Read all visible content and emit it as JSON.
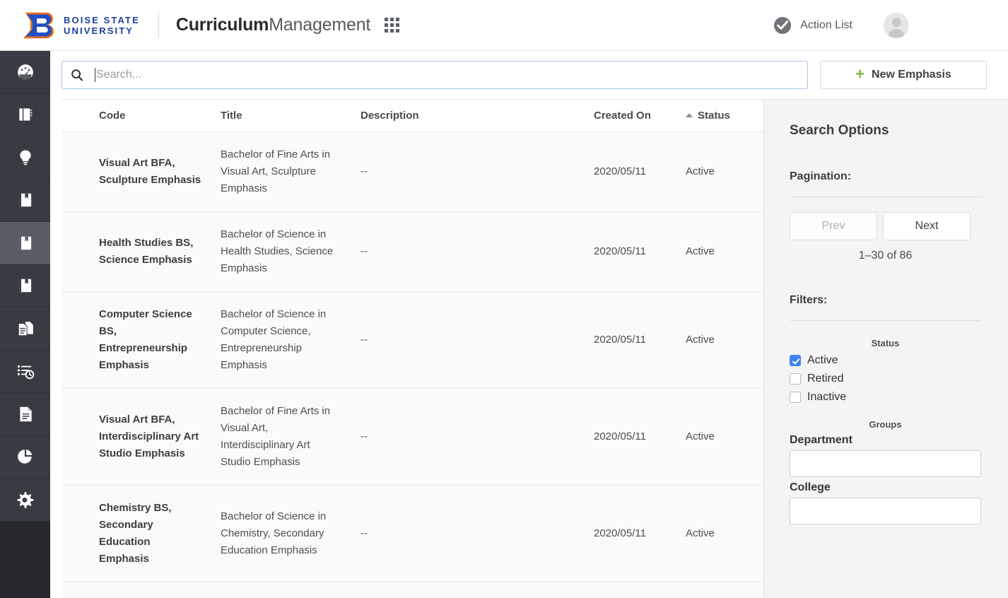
{
  "header": {
    "logo": {
      "letter": "B",
      "line1": "BOISE STATE",
      "line2": "UNIVERSITY",
      "blue": "#1f3f9e",
      "orange": "#e36c1f"
    },
    "app_title_bold": "Curriculum",
    "app_title_regular": "Management",
    "apps_grid_icon": "grid-apps-icon",
    "action_list_label": "Action List",
    "action_list_icon": "check-circle-icon",
    "avatar_icon": "user-avatar-icon"
  },
  "sidebar": {
    "items": [
      {
        "icon": "dashboard-gauge-icon",
        "active": false
      },
      {
        "icon": "book-closed-icon",
        "active": false
      },
      {
        "icon": "lightbulb-icon",
        "active": false
      },
      {
        "icon": "bookmark-book-icon",
        "active": false
      },
      {
        "icon": "bookmark-book-icon",
        "active": true
      },
      {
        "icon": "bookmark-book-icon",
        "active": false
      },
      {
        "icon": "copy-documents-icon",
        "active": false
      },
      {
        "icon": "list-clock-icon",
        "active": false
      },
      {
        "icon": "document-file-icon",
        "active": false
      },
      {
        "icon": "pie-chart-icon",
        "active": false
      },
      {
        "icon": "gear-settings-icon",
        "active": false
      }
    ]
  },
  "toolbar": {
    "search_placeholder": "Search...",
    "search_value": "",
    "search_icon": "search-magnifier-icon",
    "new_button_label": "New Emphasis",
    "new_button_plus": "+",
    "new_button_plus_color": "#7ab648"
  },
  "table": {
    "columns": [
      "Code",
      "Title",
      "Description",
      "Created On",
      "Status"
    ],
    "sorted_column": "Status",
    "sort_direction": "asc",
    "rows": [
      {
        "code": "Visual Art BFA, Sculpture Emphasis",
        "title": "Bachelor of Fine Arts in Visual Art, Sculpture Emphasis",
        "description": "--",
        "created_on": "2020/05/11",
        "status": "Active"
      },
      {
        "code": "Health Studies BS, Science Emphasis",
        "title": "Bachelor of Science in Health Studies, Science Emphasis",
        "description": "--",
        "created_on": "2020/05/11",
        "status": "Active"
      },
      {
        "code": "Computer Science BS, Entrepreneurship Emphasis",
        "title": "Bachelor of Science in Computer Science, Entrepreneurship Emphasis",
        "description": "--",
        "created_on": "2020/05/11",
        "status": "Active"
      },
      {
        "code": "Visual Art BFA, Interdisciplinary Art Studio Emphasis",
        "title": "Bachelor of Fine Arts in Visual Art, Interdisciplinary Art Studio Emphasis",
        "description": "--",
        "created_on": "2020/05/11",
        "status": "Active"
      },
      {
        "code": "Chemistry BS, Secondary Education Emphasis",
        "title": "Bachelor of Science in Chemistry, Secondary Education Emphasis",
        "description": "--",
        "created_on": "2020/05/11",
        "status": "Active"
      }
    ]
  },
  "search_options": {
    "title": "Search Options",
    "pagination_label": "Pagination:",
    "prev_label": "Prev",
    "next_label": "Next",
    "prev_disabled": true,
    "range_text": "1–30 of 86",
    "filters_label": "Filters:",
    "status_group_label": "Status",
    "status_options": [
      {
        "label": "Active",
        "checked": true
      },
      {
        "label": "Retired",
        "checked": false
      },
      {
        "label": "Inactive",
        "checked": false
      }
    ],
    "checked_color": "#3f84f3",
    "groups_label": "Groups",
    "department_label": "Department",
    "department_value": "",
    "college_label": "College",
    "college_value": ""
  }
}
